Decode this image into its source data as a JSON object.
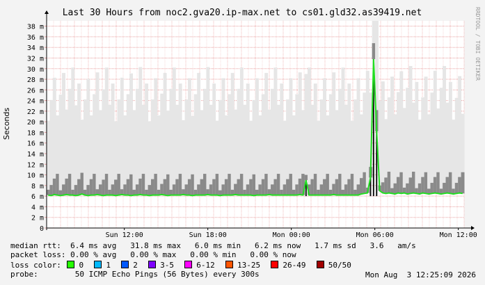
{
  "chart_data": {
    "type": "area",
    "title": "Last 30 Hours from noc2.gva20.ip-max.net to cs01.gld32.as39419.net",
    "ylabel": "Seconds",
    "xlabel": "",
    "ylim": [
      0,
      39
    ],
    "y_unit": "m",
    "yticks": [
      "0",
      "2 m",
      "4 m",
      "6 m",
      "8 m",
      "10 m",
      "12 m",
      "14 m",
      "16 m",
      "18 m",
      "20 m",
      "22 m",
      "24 m",
      "26 m",
      "28 m",
      "30 m",
      "32 m",
      "34 m",
      "36 m",
      "38 m"
    ],
    "xticks": [
      "Sun 12:00",
      "Sun 18:00",
      "Mon 00:00",
      "Mon 06:00",
      "Mon 12:00"
    ],
    "x_range": [
      "Sun 06:25",
      "Mon 12:25"
    ],
    "grid": true,
    "series": [
      {
        "name": "median rtt",
        "color": "#22dd22",
        "values": [
          6.2,
          6.1,
          6.3,
          6.2,
          6.1,
          6.2,
          6.3,
          6.2,
          6.2,
          6.1,
          6.2,
          6.4,
          6.2,
          6.1,
          6.2,
          6.2,
          6.3,
          6.2,
          6.1,
          6.2,
          6.2,
          6.2,
          6.1,
          6.2,
          6.3,
          6.2,
          6.2,
          6.1,
          6.2,
          6.2,
          6.3,
          6.2,
          6.2,
          6.1,
          6.2,
          6.2,
          6.2,
          6.3,
          6.2,
          6.1,
          6.2,
          6.2,
          6.2,
          6.2,
          6.3,
          6.2,
          6.2,
          6.1,
          6.2,
          6.2,
          6.2,
          6.2,
          6.3,
          6.2,
          6.2,
          6.2,
          6.1,
          6.2,
          6.2,
          6.2,
          6.2,
          6.3,
          6.2,
          6.2,
          6.2,
          6.2,
          6.2,
          6.1,
          6.2,
          6.2,
          6.2,
          6.2,
          6.3,
          6.2,
          6.2,
          6.2,
          6.2,
          6.2,
          6.2,
          6.2,
          6.2,
          6.2,
          6.3,
          6.2,
          9.0,
          6.2,
          6.2,
          6.2,
          6.2,
          6.2,
          6.2,
          6.2,
          6.2,
          6.3,
          6.2,
          6.2,
          6.2,
          6.2,
          6.2,
          6.2,
          6.2,
          6.2,
          6.4,
          6.5,
          6.6,
          9.5,
          31.8,
          18.2,
          7.0,
          6.6,
          6.5,
          6.6,
          6.5,
          6.4,
          6.6,
          6.5,
          6.6,
          6.4,
          6.5,
          6.6,
          6.5,
          6.4,
          6.6,
          6.5,
          6.4,
          6.5,
          6.6,
          6.5,
          6.4,
          6.5,
          6.6,
          6.5,
          6.4,
          6.5,
          6.6,
          6.5
        ]
      }
    ]
  },
  "watermark": "RRDTOOL / TOBI OETIKER",
  "legend": {
    "median_label": "median rtt:",
    "median_stats": "  6.4 ms avg   31.8 ms max   6.0 ms min   6.2 ms now   1.7 ms sd   3.6   am/s",
    "loss_label": "packet loss:",
    "loss_stats": " 0.00 % avg   0.00 % max   0.00 % min   0.00 % now",
    "color_label": "loss color:",
    "color_entries": [
      {
        "label": "0",
        "color": "#26ff00"
      },
      {
        "label": "1",
        "color": "#00b8ff"
      },
      {
        "label": "2",
        "color": "#0059ff"
      },
      {
        "label": "3-5",
        "color": "#7e00ff"
      },
      {
        "label": "6-12",
        "color": "#ff00ff"
      },
      {
        "label": "13-25",
        "color": "#ff5500"
      },
      {
        "label": "26-49",
        "color": "#ff0000"
      },
      {
        "label": "50/50",
        "color": "#a10000"
      }
    ],
    "probe_label": "probe:",
    "probe_text": "        50 ICMP Echo Pings (56 Bytes) every 300s",
    "probe_date": "Mon Aug  3 12:25:09 2026"
  }
}
